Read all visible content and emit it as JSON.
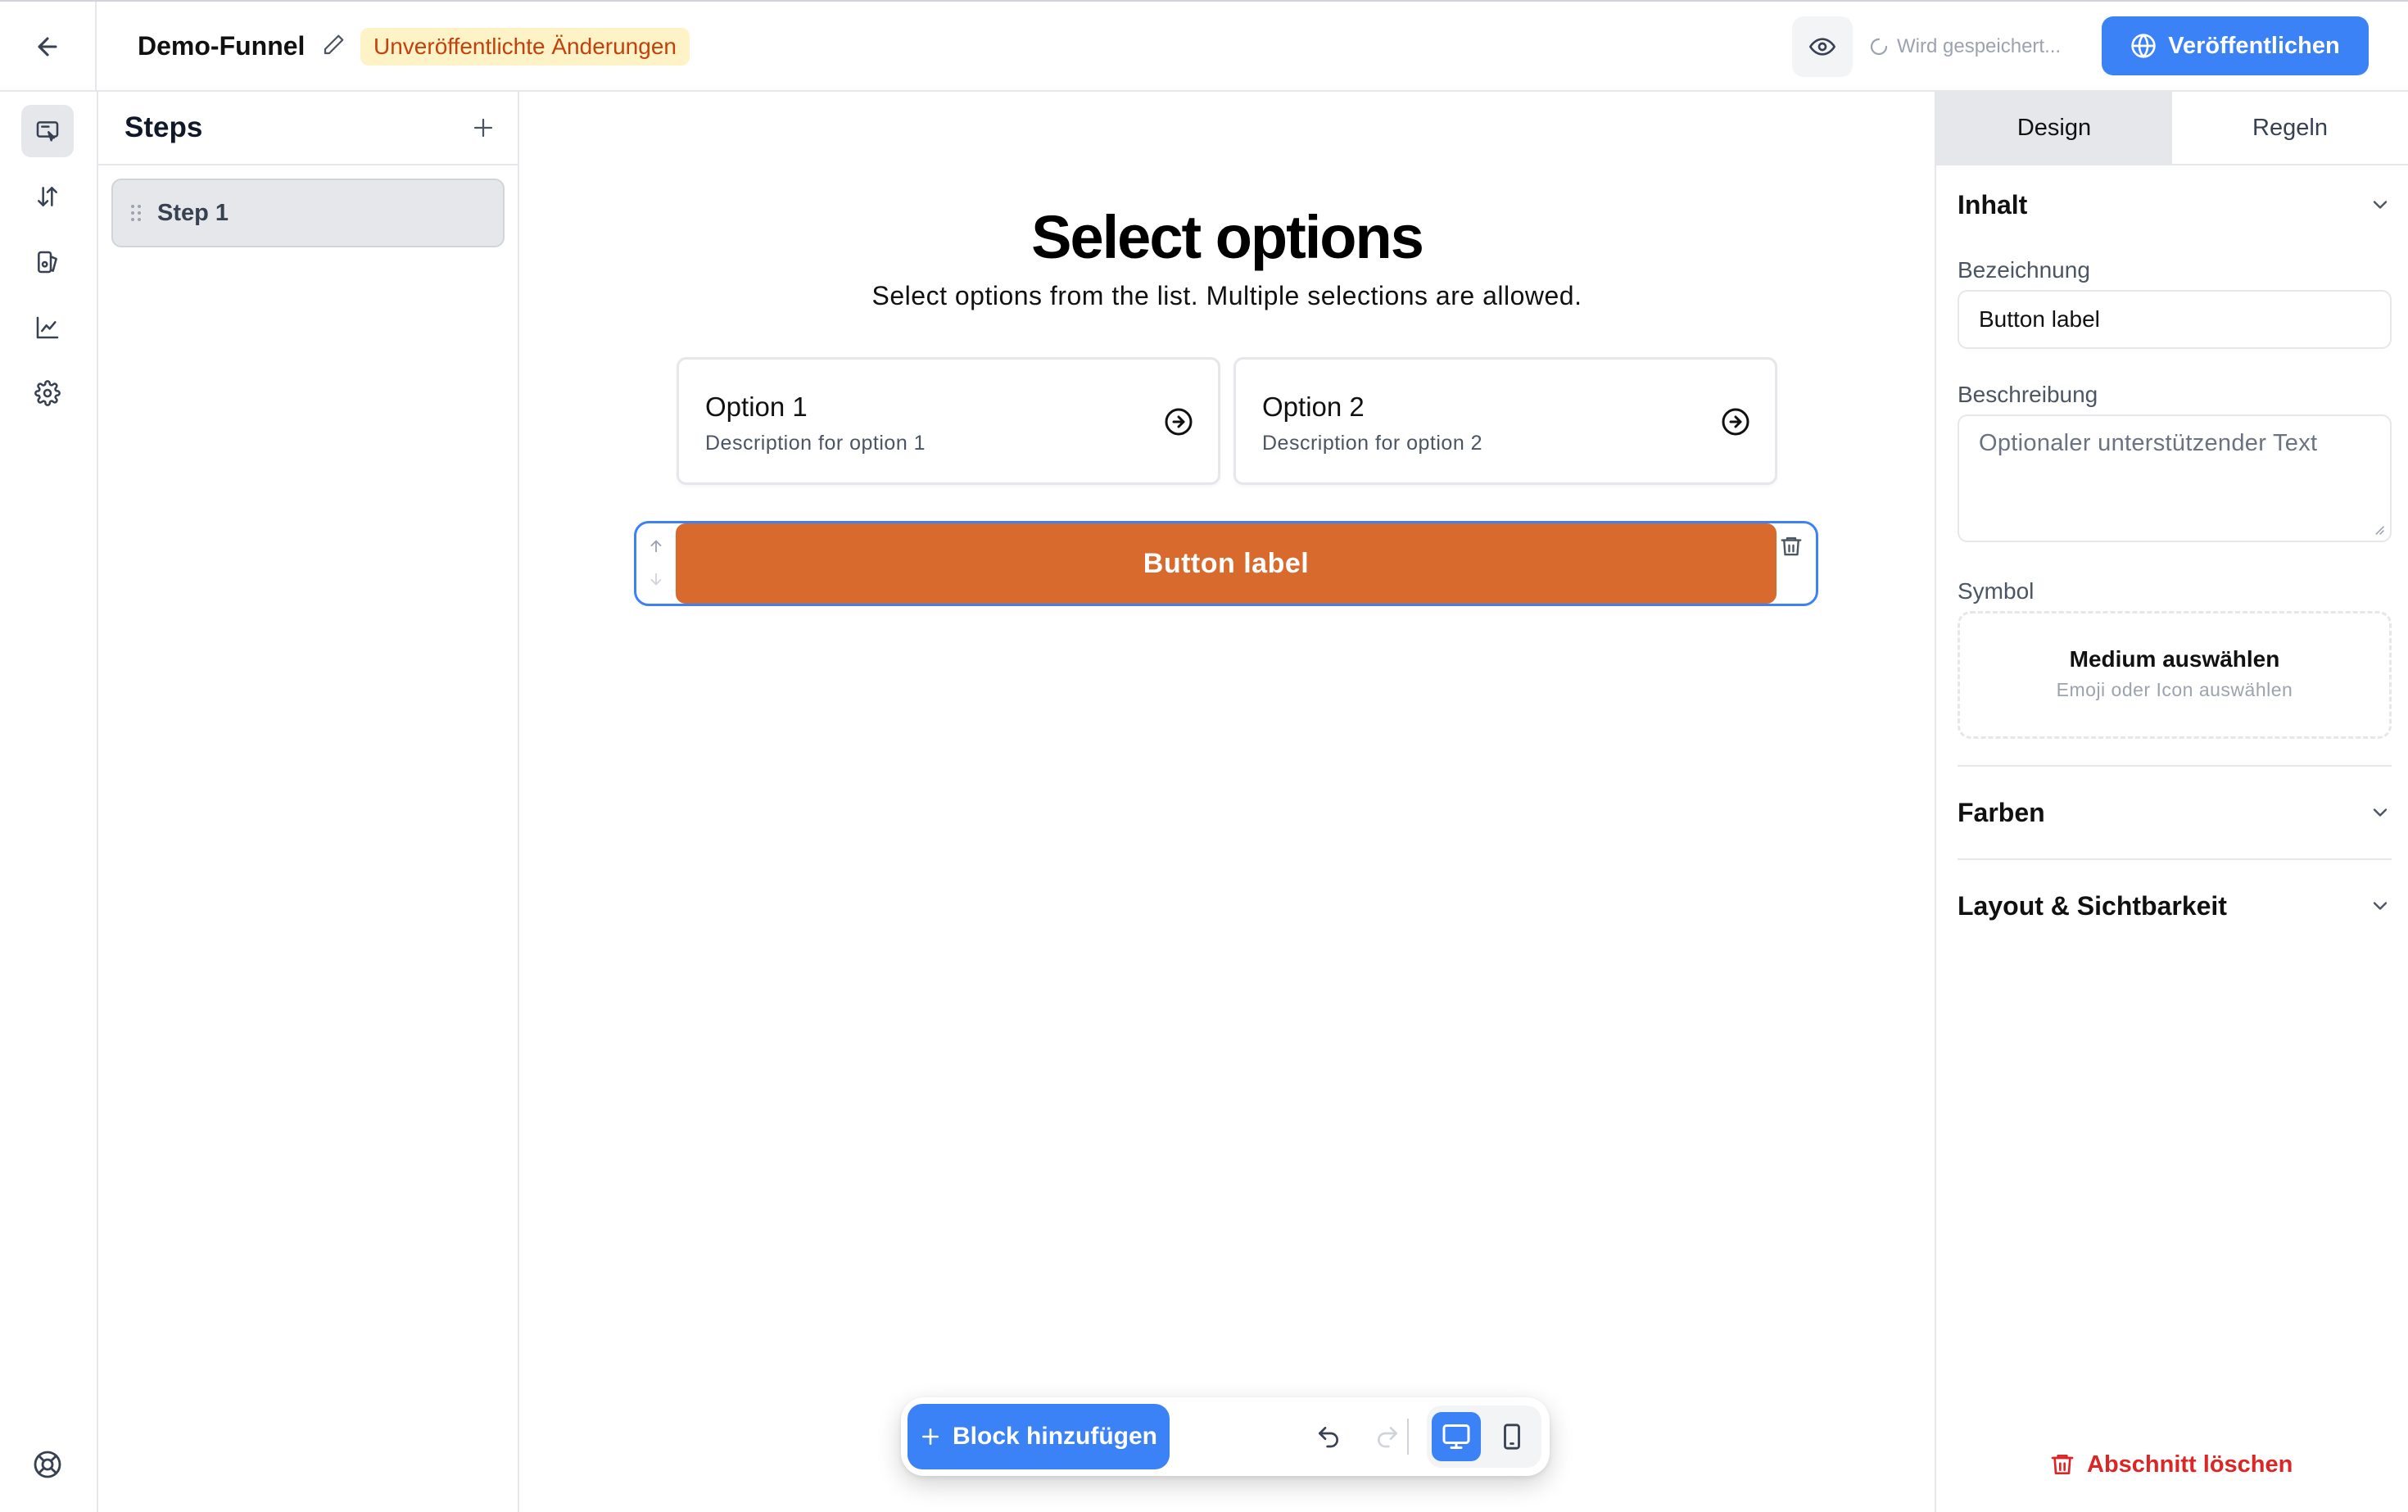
{
  "header": {
    "funnel_title": "Demo-Funnel",
    "status_badge": "Unveröffentlichte Änderungen",
    "saving_status": "Wird gespeichert...",
    "publish_label": "Veröffentlichen",
    "icons": [
      "arrow-left-icon",
      "pencil-icon",
      "eye-icon",
      "spinner-icon",
      "globe-icon"
    ]
  },
  "rail": {
    "items": [
      "editor-icon",
      "sort-icon",
      "templates-icon",
      "analytics-icon",
      "settings-icon"
    ],
    "active": "editor-icon",
    "footer_icon": "help-lifebuoy-icon"
  },
  "steps": {
    "title": "Steps",
    "items": [
      {
        "label": "Step 1",
        "selected": true
      }
    ]
  },
  "canvas": {
    "title": "Select options",
    "subtitle": "Select options from the list. Multiple selections are allowed.",
    "options": [
      {
        "title": "Option 1",
        "description": "Description for option 1"
      },
      {
        "title": "Option 2",
        "description": "Description for option 2"
      }
    ],
    "button_label": "Button label",
    "button_color": "#d96a2e",
    "selection_color": "#3b82f6"
  },
  "toolbar": {
    "add_block_label": "Block hinzufügen",
    "undo_icon": "undo-icon",
    "redo_icon": "redo-icon",
    "device_active": "desktop"
  },
  "properties": {
    "tabs": [
      {
        "label": "Design",
        "active": true
      },
      {
        "label": "Regeln",
        "active": false
      }
    ],
    "content_section": "Inhalt",
    "label_field": {
      "label": "Bezeichnung",
      "value": "Button label"
    },
    "description_field": {
      "label": "Beschreibung",
      "placeholder": "Optionaler unterstützender Text"
    },
    "symbol_field": {
      "label": "Symbol",
      "picker_title": "Medium auswählen",
      "picker_subtitle": "Emoji oder Icon auswählen"
    },
    "colors_section": "Farben",
    "layout_section": "Layout & Sichtbarkeit",
    "delete_label": "Abschnitt löschen"
  },
  "colors": {
    "accent": "#3b82f6",
    "warning_bg": "#fef3c7",
    "warning_text": "#c2410c",
    "danger": "#dc2626"
  }
}
